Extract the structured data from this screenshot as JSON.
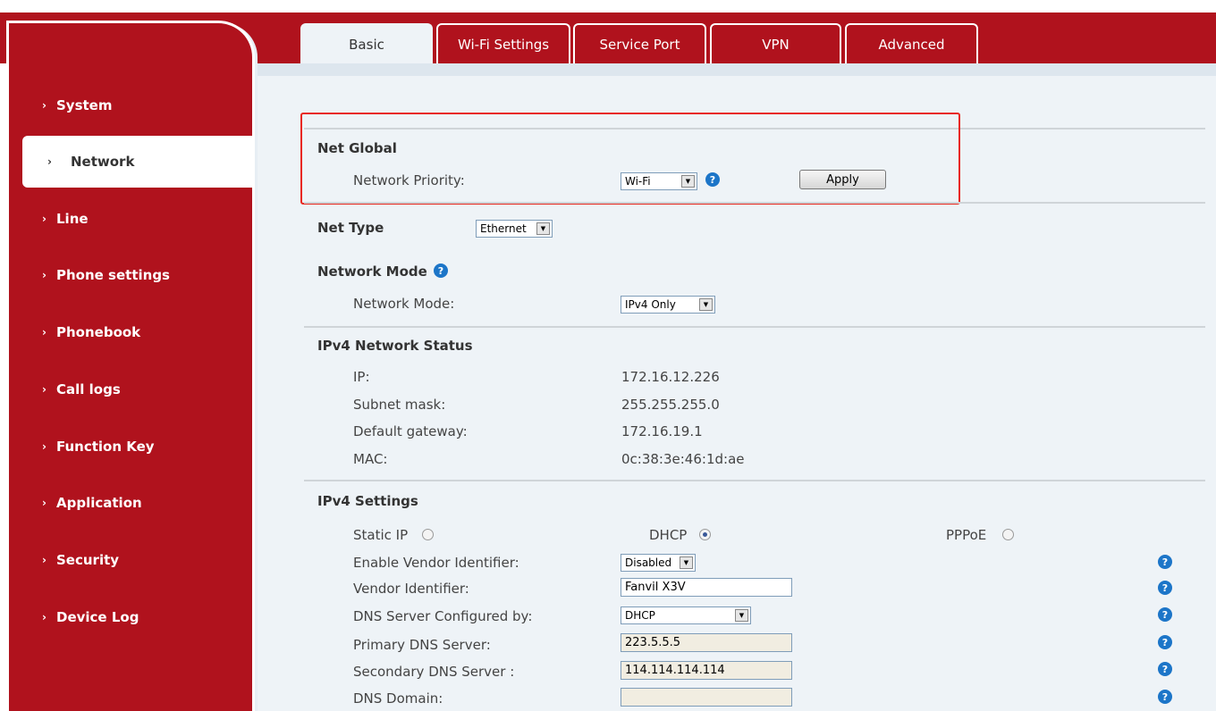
{
  "tabs": [
    "Basic",
    "Wi-Fi Settings",
    "Service Port",
    "VPN",
    "Advanced"
  ],
  "sidebar": {
    "items": [
      "System",
      "Network",
      "Line",
      "Phone settings",
      "Phonebook",
      "Call logs",
      "Function Key",
      "Application",
      "Security",
      "Device Log"
    ],
    "active": "Network"
  },
  "net_global": {
    "title": "Net Global",
    "priority_label": "Network Priority:",
    "priority_value": "Wi-Fi",
    "apply_label": "Apply"
  },
  "net_type": {
    "title": "Net Type",
    "value": "Ethernet"
  },
  "network_mode": {
    "title": "Network Mode",
    "label": "Network Mode:",
    "value": "IPv4 Only"
  },
  "ipv4_status": {
    "title": "IPv4 Network Status",
    "ip_label": "IP:",
    "ip": "172.16.12.226",
    "mask_label": "Subnet mask:",
    "mask": "255.255.255.0",
    "gw_label": "Default gateway:",
    "gw": "172.16.19.1",
    "mac_label": "MAC:",
    "mac": "0c:38:3e:46:1d:ae"
  },
  "ipv4_settings": {
    "title": "IPv4 Settings",
    "static_ip": "Static IP",
    "dhcp": "DHCP",
    "pppoe": "PPPoE",
    "selected_mode": "DHCP",
    "vendor_enable_label": "Enable Vendor Identifier:",
    "vendor_enable_value": "Disabled",
    "vendor_id_label": "Vendor Identifier:",
    "vendor_id_value": "Fanvil X3V",
    "dns_by_label": "DNS Server Configured by:",
    "dns_by_value": "DHCP",
    "dns1_label": "Primary DNS Server:",
    "dns1_value": "223.5.5.5",
    "dns2_label": "Secondary DNS Server :",
    "dns2_value": "114.114.114.114",
    "dns_domain_label": "DNS Domain:",
    "dns_domain_value": ""
  },
  "icons": {
    "help": "question-mark",
    "dropdown": "triangle-down",
    "chevron": "chevron-right"
  },
  "colors": {
    "brand_red": "#b0121d",
    "highlight": "#e8281e",
    "help_blue": "#1c75c8",
    "content_bg": "#eef3f7"
  }
}
